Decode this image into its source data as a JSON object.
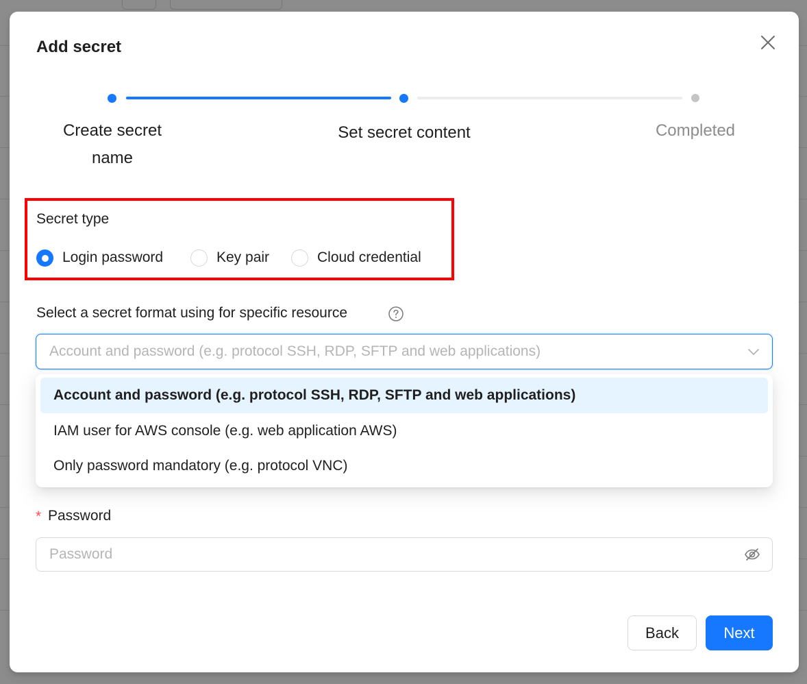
{
  "modal": {
    "title": "Add secret",
    "close_icon": "close-icon"
  },
  "steps": [
    {
      "line1": "Create secret",
      "line2": "name",
      "status": "done"
    },
    {
      "label": "Set secret content",
      "status": "active"
    },
    {
      "label": "Completed",
      "status": "wait"
    }
  ],
  "secret_type": {
    "label": "Secret type",
    "options": [
      {
        "label": "Login password",
        "checked": true
      },
      {
        "label": "Key pair",
        "checked": false
      },
      {
        "label": "Cloud credential",
        "checked": false
      }
    ]
  },
  "format": {
    "label": "Select a secret format using for specific resource",
    "help_icon": "question-circle-icon",
    "placeholder": "Account and password (e.g. protocol SSH, RDP, SFTP and web applications)",
    "options": [
      {
        "label": "Account and password (e.g. protocol SSH, RDP, SFTP and web applications)",
        "selected": true
      },
      {
        "label": "IAM user for AWS console (e.g. web application AWS)",
        "selected": false
      },
      {
        "label": "Only password mandatory (e.g. protocol VNC)",
        "selected": false
      }
    ]
  },
  "password": {
    "required_mark": "*",
    "label": "Password",
    "placeholder": "Password",
    "icon": "eye-invisible-icon"
  },
  "footer": {
    "back_label": "Back",
    "next_label": "Next"
  },
  "colors": {
    "primary": "#1677ff",
    "highlight_border": "#ff0000",
    "required": "#ff4d4f"
  }
}
